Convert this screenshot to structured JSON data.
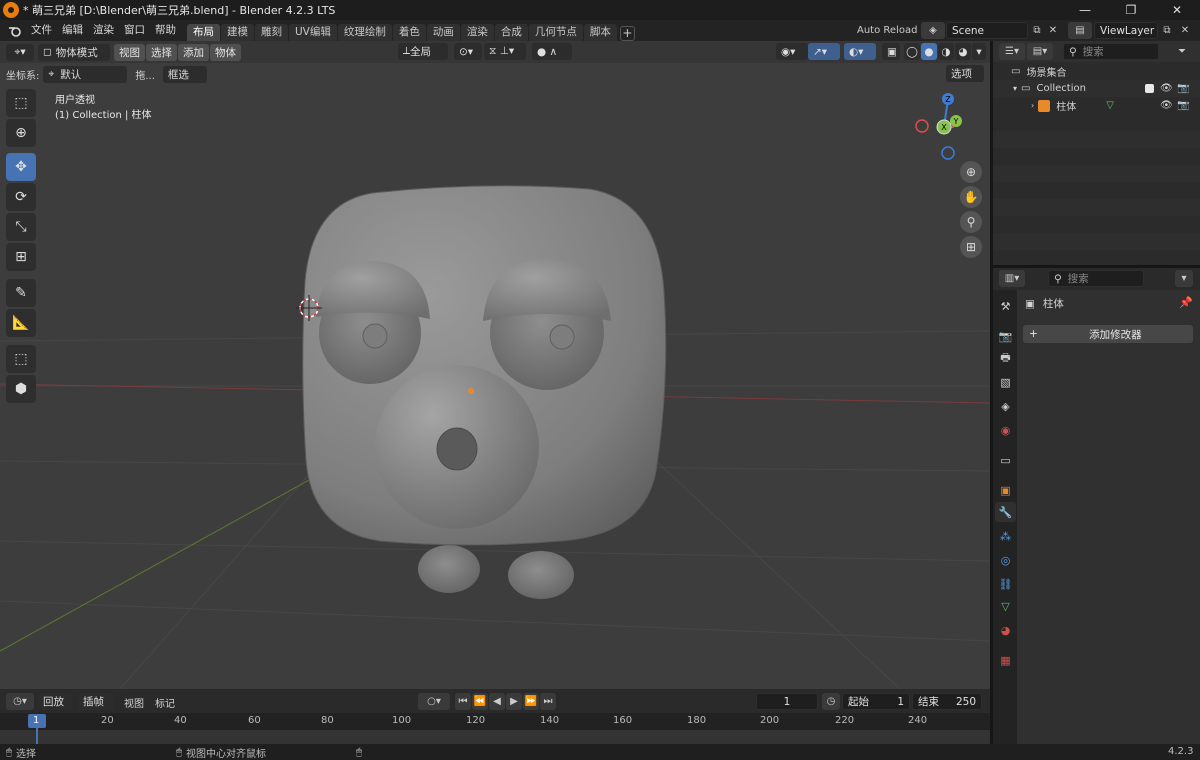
{
  "window": {
    "title": "* 萌三兄弟 [D:\\Blender\\萌三兄弟.blend] - Blender 4.2.3 LTS",
    "min_icon": "minimize-icon",
    "max_icon": "restore-icon",
    "close_icon": "close-icon"
  },
  "menus": [
    "文件",
    "编辑",
    "渲染",
    "窗口",
    "帮助"
  ],
  "workspaces": [
    "布局",
    "建模",
    "雕刻",
    "UV编辑",
    "纹理绘制",
    "着色",
    "动画",
    "渲染",
    "合成",
    "几何节点",
    "脚本"
  ],
  "workspace_add": "+",
  "auto_reload": "Auto Reload",
  "scene": {
    "label": "Scene"
  },
  "view_layer": {
    "label": "ViewLayer"
  },
  "viewport": {
    "mode": "物体模式",
    "menus": [
      "视图",
      "选择",
      "添加",
      "物体"
    ],
    "transform_orientation": "全局",
    "coord_label": "坐标系:",
    "coord_value": "默认",
    "drag_label": "拖...",
    "select_box": "框选",
    "options": "选项",
    "overlay_line1": "用户透视",
    "overlay_line2": "(1) Collection | 柱体",
    "gizmo_axes": [
      "Z",
      "Y",
      "X"
    ]
  },
  "outliner": {
    "search_placeholder": "搜索",
    "scene_collection": "场景集合",
    "collection": "Collection",
    "object": "柱体"
  },
  "properties": {
    "search_placeholder": "搜索",
    "object_name": "柱体",
    "add_modifier": "添加修改器",
    "plus": "+"
  },
  "timeline": {
    "playback": "回放",
    "keying": "插帧",
    "view": "视图",
    "marker": "标记",
    "current_frame": "1",
    "start_label": "起始",
    "start_value": "1",
    "end_label": "结束",
    "end_value": "250",
    "ruler": [
      "1",
      "20",
      "40",
      "60",
      "80",
      "100",
      "120",
      "140",
      "160",
      "180",
      "200",
      "220",
      "240"
    ]
  },
  "status": {
    "select": "选择",
    "center_view": "视图中心对齐鼠标",
    "version": "4.2.3"
  },
  "colors": {
    "accent": "#4772b3",
    "brand": "#e87d0d",
    "x_axis": "#e04d4d",
    "y_axis": "#8bc34a",
    "z_axis": "#3d7dd8"
  }
}
